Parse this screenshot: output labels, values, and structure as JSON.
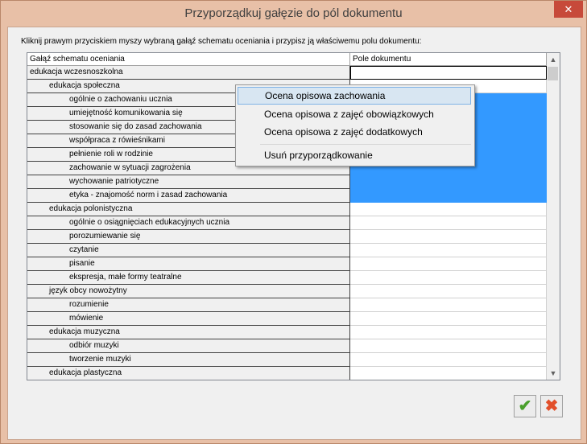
{
  "window": {
    "title": "Przyporządkuj gałęzie do pól dokumentu",
    "close_icon": "✕"
  },
  "instruction": "Kliknij prawym przyciskiem myszy wybraną gałąź schematu oceniania i przypisz ją właściwemu polu dokumentu:",
  "grid": {
    "headers": [
      "Gałąź schematu oceniania",
      "Pole dokumentu"
    ],
    "rows": [
      {
        "label": "edukacja wczesnoszkolna",
        "level": 0,
        "selected": false,
        "focused": true
      },
      {
        "label": "edukacja społeczna",
        "level": 1,
        "selected": false
      },
      {
        "label": "ogólnie o zachowaniu ucznia",
        "level": 2,
        "selected": true
      },
      {
        "label": "umiejętność komunikowania się",
        "level": 2,
        "selected": true
      },
      {
        "label": "stosowanie się do zasad zachowania",
        "level": 2,
        "selected": true
      },
      {
        "label": "współpraca z rówieśnikami",
        "level": 2,
        "selected": true
      },
      {
        "label": "pełnienie roli w rodzinie",
        "level": 2,
        "selected": true
      },
      {
        "label": "zachowanie w sytuacji zagrożenia",
        "level": 2,
        "selected": true
      },
      {
        "label": "wychowanie patriotyczne",
        "level": 2,
        "selected": true
      },
      {
        "label": "etyka - znajomość norm i zasad zachowania",
        "level": 2,
        "selected": true
      },
      {
        "label": "edukacja polonistyczna",
        "level": 1,
        "selected": false
      },
      {
        "label": "ogólnie o osiągnięciach edukacyjnych ucznia",
        "level": 2,
        "selected": false
      },
      {
        "label": "porozumiewanie się",
        "level": 2,
        "selected": false
      },
      {
        "label": "czytanie",
        "level": 2,
        "selected": false
      },
      {
        "label": "pisanie",
        "level": 2,
        "selected": false
      },
      {
        "label": "ekspresja, małe formy teatralne",
        "level": 2,
        "selected": false
      },
      {
        "label": "język obcy nowożytny",
        "level": 1,
        "selected": false
      },
      {
        "label": "rozumienie",
        "level": 2,
        "selected": false
      },
      {
        "label": "mówienie",
        "level": 2,
        "selected": false
      },
      {
        "label": "edukacja muzyczna",
        "level": 1,
        "selected": false
      },
      {
        "label": "odbiór muzyki",
        "level": 2,
        "selected": false
      },
      {
        "label": "tworzenie muzyki",
        "level": 2,
        "selected": false
      },
      {
        "label": "edukacja plastyczna",
        "level": 1,
        "selected": false
      }
    ],
    "scroll_up_icon": "▲",
    "scroll_down_icon": "▼"
  },
  "context_menu": {
    "items": [
      "Ocena opisowa zachowania",
      "Ocena opisowa z zajęć obowiązkowych",
      "Ocena opisowa z zajęć dodatkowych",
      "Usuń przyporządkowanie"
    ],
    "highlighted_index": 0
  },
  "buttons": {
    "ok_icon": "✔",
    "cancel_icon": "✖"
  },
  "colors": {
    "selection": "#3399ff",
    "frame": "#e8c0a7",
    "ok": "#4aa02c",
    "cancel": "#e24f2a"
  }
}
